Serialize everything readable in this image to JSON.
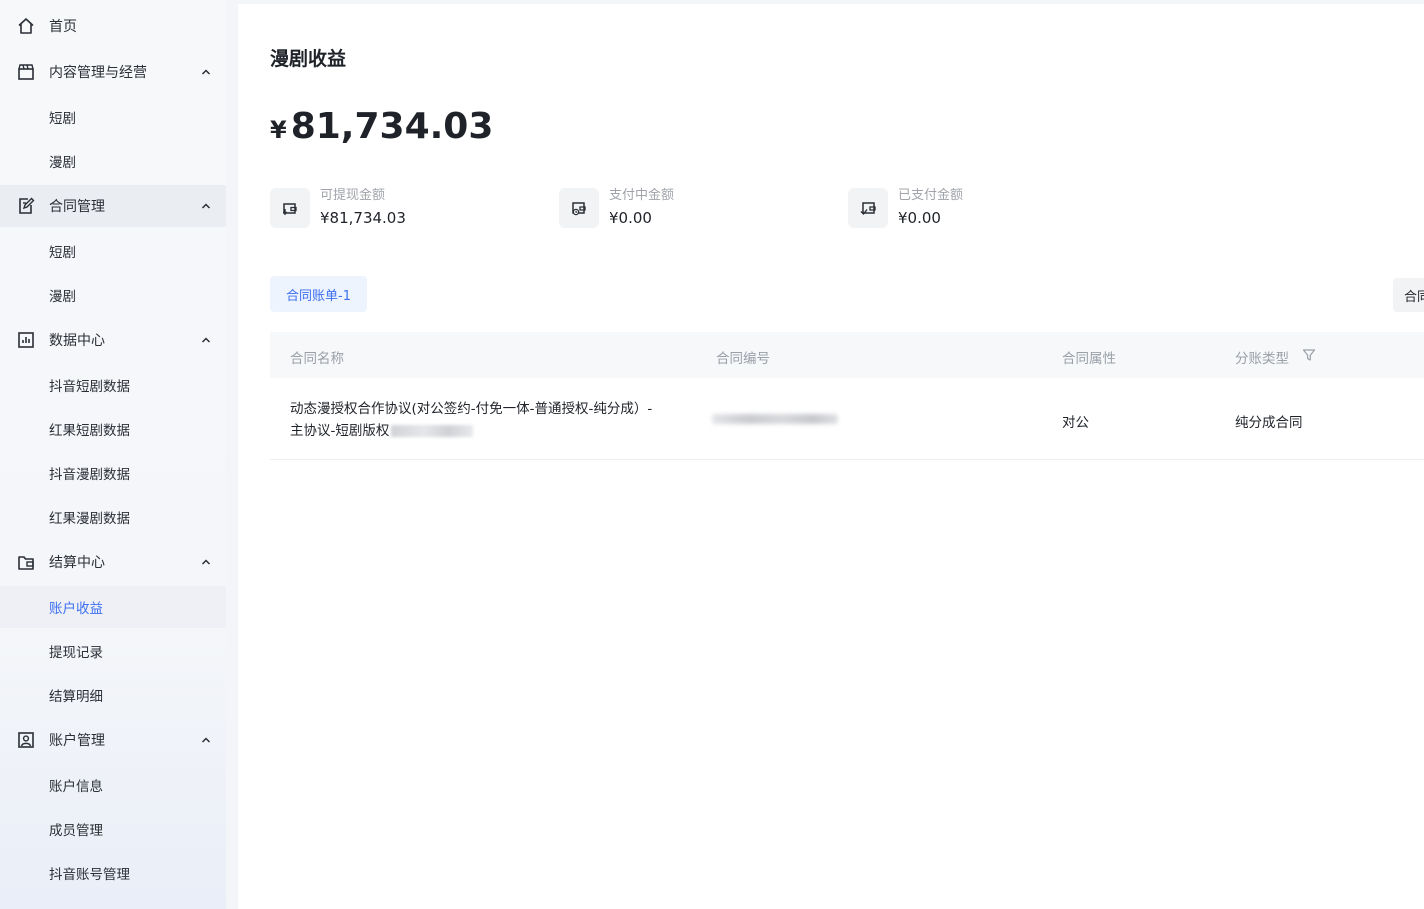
{
  "sidebar": {
    "home": "首页",
    "content_group": {
      "label": "内容管理与经营",
      "items": [
        "短剧",
        "漫剧"
      ]
    },
    "contract_group": {
      "label": "合同管理",
      "items": [
        "短剧",
        "漫剧"
      ]
    },
    "data_group": {
      "label": "数据中心",
      "items": [
        "抖音短剧数据",
        "红果短剧数据",
        "抖音漫剧数据",
        "红果漫剧数据"
      ]
    },
    "settlement_group": {
      "label": "结算中心",
      "items": [
        "账户收益",
        "提现记录",
        "结算明细"
      ],
      "selected": "账户收益"
    },
    "account_group": {
      "label": "账户管理",
      "items": [
        "账户信息",
        "成员管理",
        "抖音账号管理"
      ]
    }
  },
  "page": {
    "title": "漫剧收益",
    "currency_symbol": "¥",
    "total_amount": "81,734.03"
  },
  "stats": [
    {
      "label": "可提现金额",
      "value": "¥81,734.03",
      "icon": "withdraw-wallet-icon"
    },
    {
      "label": "支付中金额",
      "value": "¥0.00",
      "icon": "paying-wallet-icon"
    },
    {
      "label": "已支付金额",
      "value": "¥0.00",
      "icon": "paid-wallet-icon"
    }
  ],
  "tabs": {
    "active": "合同账单-1",
    "right_partial": "合同"
  },
  "table": {
    "headers": [
      "合同名称",
      "合同编号",
      "合同属性",
      "分账类型"
    ],
    "rows": [
      {
        "name_line1": "动态漫授权合作协议(对公签约-付免一体-普通授权-纯分成）-",
        "name_line2": "主协议-短剧版权",
        "attribute": "对公",
        "split_type": "纯分成合同"
      }
    ]
  },
  "colors": {
    "accent": "#3d6ff0",
    "selected_bg": "#eef0f5",
    "tab_bg": "#eef4fd"
  }
}
